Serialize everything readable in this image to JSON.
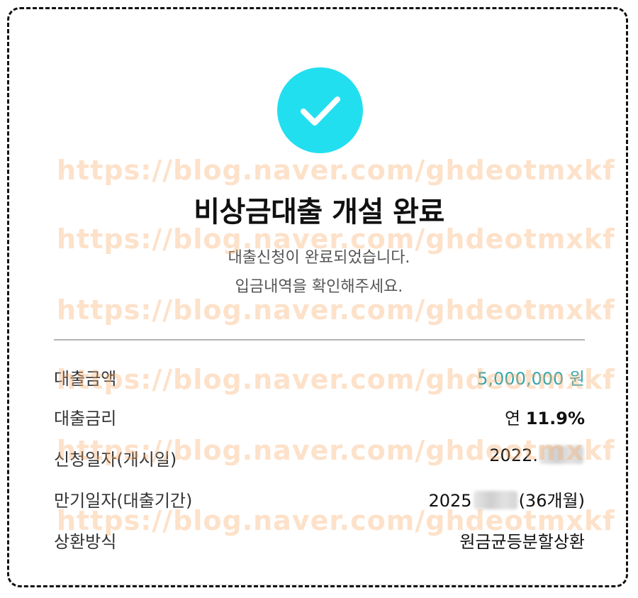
{
  "header": {
    "icon": "check-circle-icon",
    "title": "비상금대출 개설 완료",
    "subtitle_line1": "대출신청이 완료되었습니다.",
    "subtitle_line2": "입금내역을 확인해주세요."
  },
  "details": {
    "amount_label": "대출금액",
    "amount_value": "5,000,000 원",
    "rate_label": "대출금리",
    "rate_prefix": "연",
    "rate_value": "11.9%",
    "apply_date_label": "신청일자(개시일)",
    "apply_date_value": "2022.",
    "maturity_label": "만기일자(대출기간)",
    "maturity_year": "2025",
    "maturity_period": "(36개월)",
    "repayment_label": "상환방식",
    "repayment_value": "원금균등분할상환"
  },
  "watermark": {
    "text": "https://blog.naver.com/ghdeotmxkf"
  },
  "colors": {
    "check_circle": "#22dff0",
    "amount_accent": "#2ea5ae",
    "watermark": "#faaa64"
  }
}
